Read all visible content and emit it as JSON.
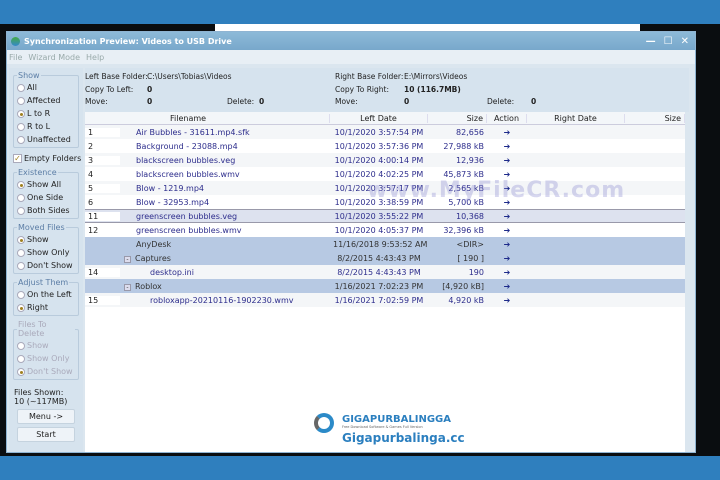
{
  "window": {
    "title": "Synchronization Preview: Videos to USB Drive",
    "controls": [
      "—",
      "☐",
      "✕"
    ]
  },
  "menu": [
    "File",
    "Wizard Mode",
    "Help"
  ],
  "show": {
    "legend": "Show",
    "options": [
      {
        "label": "All",
        "on": false
      },
      {
        "label": "Affected",
        "on": false
      },
      {
        "label": "L to R",
        "on": true
      },
      {
        "label": "R to L",
        "on": false
      },
      {
        "label": "Unaffected",
        "on": false
      }
    ]
  },
  "empty_folders": {
    "label": "Empty Folders",
    "checked": true
  },
  "existence": {
    "legend": "Existence",
    "options": [
      {
        "label": "Show All",
        "on": true
      },
      {
        "label": "One Side",
        "on": false
      },
      {
        "label": "Both Sides",
        "on": false
      }
    ]
  },
  "moved": {
    "legend": "Moved Files",
    "options": [
      {
        "label": "Show",
        "on": true
      },
      {
        "label": "Show Only",
        "on": false
      },
      {
        "label": "Don't Show",
        "on": false
      }
    ]
  },
  "adjust": {
    "legend": "Adjust Them",
    "options": [
      {
        "label": "On the Left",
        "on": false
      },
      {
        "label": "Right",
        "on": true
      }
    ]
  },
  "delete": {
    "legend": "Files To Delete",
    "options": [
      {
        "label": "Show",
        "on": false
      },
      {
        "label": "Show Only",
        "on": false
      },
      {
        "label": "Don't Show",
        "on": true
      }
    ]
  },
  "files_shown": {
    "label": "Files Shown:",
    "value": "10 (~117MB)"
  },
  "buttons": {
    "menu": "Menu ->",
    "start": "Start"
  },
  "info": {
    "left_base_label": "Left Base Folder:",
    "left_base": "C:\\Users\\Tobias\\Videos",
    "copy_left_label": "Copy To Left:",
    "copy_left": "0",
    "move_label": "Move:",
    "move_left": "0",
    "delete_label": "Delete:",
    "delete_left": "0",
    "right_base_label": "Right Base Folder:",
    "right_base": "E:\\Mirrors\\Videos",
    "copy_right_label": "Copy To Right:",
    "copy_right": "10 (116.7MB)",
    "move_right": "0",
    "delete_right": "0"
  },
  "columns": [
    "",
    "Filename",
    "Left Date",
    "Size",
    "Action",
    "Right Date",
    "Size"
  ],
  "rows": [
    {
      "n": "1",
      "name": "Air Bubbles - 31611.mp4.sfk",
      "date": "10/1/2020 3:57:54 PM",
      "size": "82,656",
      "type": "file"
    },
    {
      "n": "2",
      "name": "Background - 23088.mp4",
      "date": "10/1/2020 3:57:36 PM",
      "size": "27,988 kB",
      "type": "file"
    },
    {
      "n": "3",
      "name": "blackscreen bubbles.veg",
      "date": "10/1/2020 4:00:14 PM",
      "size": "12,936",
      "type": "file"
    },
    {
      "n": "4",
      "name": "blackscreen bubbles.wmv",
      "date": "10/1/2020 4:02:25 PM",
      "size": "45,873 kB",
      "type": "file"
    },
    {
      "n": "5",
      "name": "Blow - 1219.mp4",
      "date": "10/1/2020 3:57:17 PM",
      "size": "2,565 kB",
      "type": "file"
    },
    {
      "n": "6",
      "name": "Blow - 32953.mp4",
      "date": "10/1/2020 3:38:59 PM",
      "size": "5,700 kB",
      "type": "file"
    },
    {
      "n": "11",
      "name": "greenscreen bubbles.veg",
      "date": "10/1/2020 3:55:22 PM",
      "size": "10,368",
      "type": "sel"
    },
    {
      "n": "12",
      "name": "greenscreen bubbles.wmv",
      "date": "10/1/2020 4:05:37 PM",
      "size": "32,396 kB",
      "type": "file"
    },
    {
      "n": "",
      "name": "AnyDesk",
      "date": "11/16/2018 9:53:52 AM",
      "size": "<DIR>",
      "type": "dir"
    },
    {
      "n": "",
      "name": "Captures",
      "date": "8/2/2015 4:43:43 PM",
      "size": "[ 190 ]",
      "type": "dirx"
    },
    {
      "n": "14",
      "name": "desktop.ini",
      "date": "8/2/2015 4:43:43 PM",
      "size": "190",
      "type": "child"
    },
    {
      "n": "",
      "name": "Roblox",
      "date": "1/16/2021 7:02:23 PM",
      "size": "[4,920 kB]",
      "type": "dirx"
    },
    {
      "n": "15",
      "name": "robloxapp-20210116-1902230.wmv",
      "date": "1/16/2021 7:02:59 PM",
      "size": "4,920 kB",
      "type": "child"
    }
  ],
  "action_icon": "arrow-right-icon",
  "watermark": "www.MyFileCR.com",
  "logo": {
    "brand": "GIGAPURBALINGGA",
    "tagline": "Free Download Software & Games Full Version",
    "site": "Gigapurbalinga.cc"
  }
}
